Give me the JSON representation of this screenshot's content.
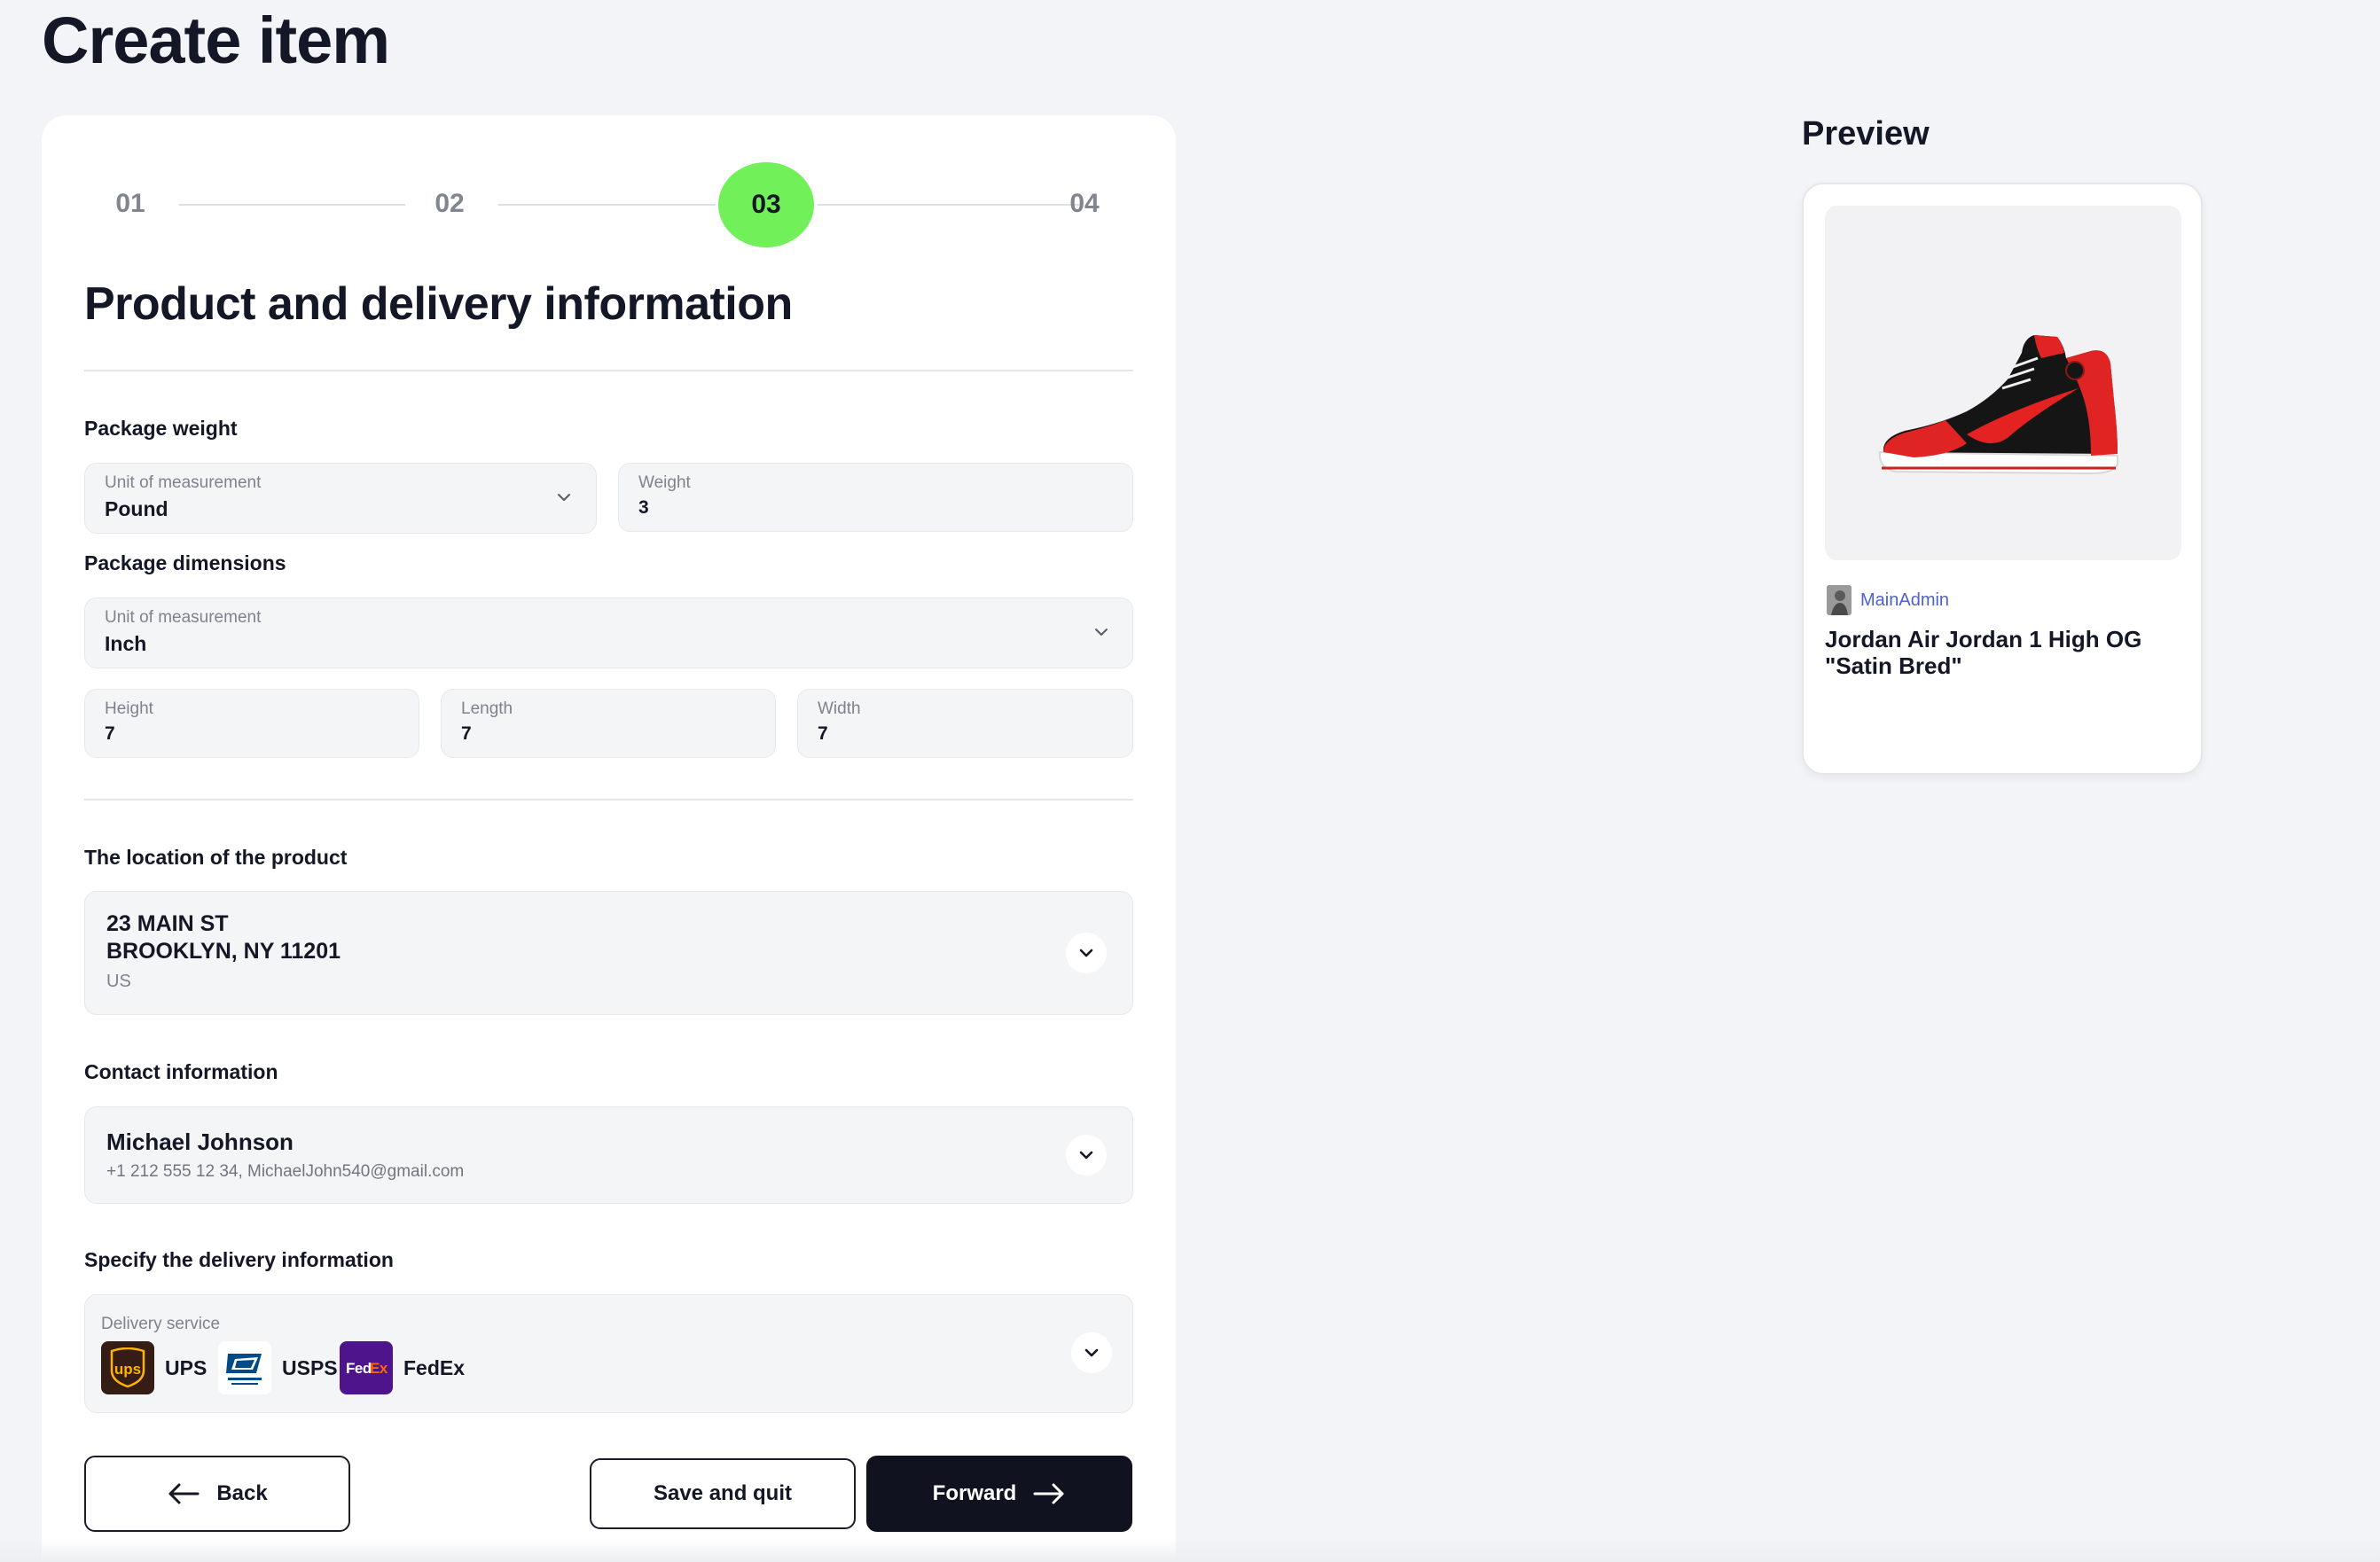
{
  "page": {
    "title": "Create item"
  },
  "stepper": {
    "steps": [
      "01",
      "02",
      "03",
      "04"
    ],
    "active_index": 2
  },
  "form": {
    "section_title": "Product and delivery information",
    "package_weight": {
      "label": "Package weight",
      "unit": {
        "label": "Unit of measurement",
        "value": "Pound"
      },
      "weight": {
        "label": "Weight",
        "value": "3"
      }
    },
    "package_dimensions": {
      "label": "Package dimensions",
      "unit": {
        "label": "Unit of measurement",
        "value": "Inch"
      },
      "height": {
        "label": "Height",
        "value": "7"
      },
      "length": {
        "label": "Length",
        "value": "7"
      },
      "width": {
        "label": "Width",
        "value": "7"
      }
    },
    "location": {
      "label": "The location of the product",
      "line1": "23 MAIN ST",
      "line2": "BROOKLYN, NY 11201",
      "country": "US"
    },
    "contact": {
      "label": "Contact information",
      "name": "Michael Johnson",
      "details": "+1 212 555 12 34, MichaelJohn540@gmail.com"
    },
    "delivery": {
      "label": "Specify the delivery information",
      "field_label": "Delivery service",
      "carriers": [
        {
          "name": "UPS",
          "icon": "ups-logo-icon",
          "color": "#351c15"
        },
        {
          "name": "USPS",
          "icon": "usps-logo-icon",
          "color": "#004b87"
        },
        {
          "name": "FedEx",
          "icon": "fedex-logo-icon",
          "color": "#4d148c"
        }
      ],
      "logo_texts": {
        "ups": "ups",
        "fedex_fed": "Fed",
        "fedex_ex": "Ex"
      }
    }
  },
  "actions": {
    "back": "Back",
    "save_quit": "Save and quit",
    "forward": "Forward"
  },
  "preview": {
    "title": "Preview",
    "seller": "MainAdmin",
    "product_name": "Jordan Air Jordan 1 High OG \"Satin Bred\"",
    "image": "red-black-sneaker"
  },
  "colors": {
    "accent_green": "#72f05a",
    "dark": "#10131f",
    "seller_link": "#4e5fcf"
  }
}
